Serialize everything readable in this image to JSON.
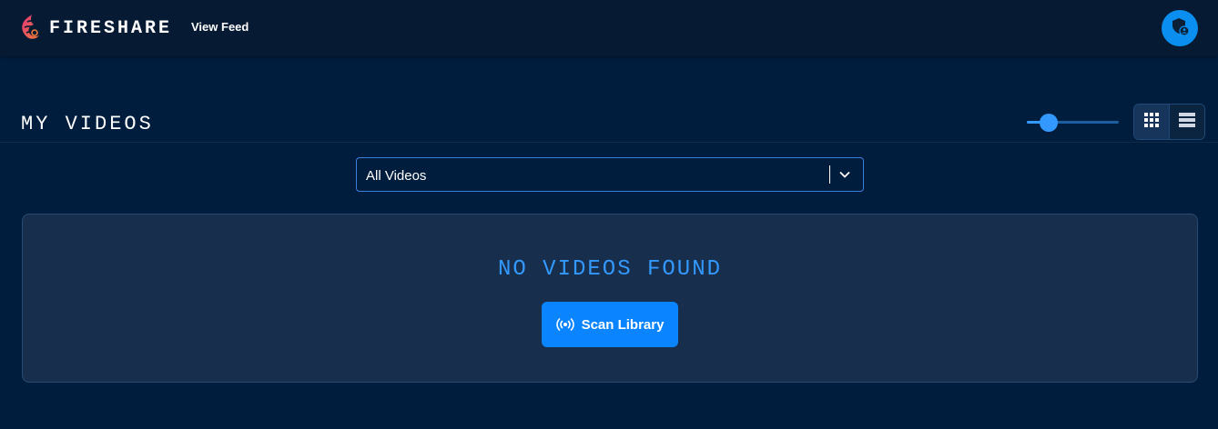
{
  "header": {
    "brand": "FIRESHARE",
    "logo_icon": "fireshare-logo-icon",
    "nav_link": "View Feed",
    "avatar_icon": "shield-user-icon"
  },
  "toolbar": {
    "title": "MY VIDEOS",
    "size_slider_level": 0.24,
    "views": [
      {
        "name": "grid-view",
        "icon": "grid-icon",
        "active": true
      },
      {
        "name": "list-view",
        "icon": "list-icon",
        "active": false
      }
    ]
  },
  "filter": {
    "selected": "All Videos",
    "icon": "chevron-down-icon"
  },
  "empty_state": {
    "message": "NO VIDEOS FOUND",
    "button_label": "Scan Library",
    "button_icon": "broadcast-icon"
  },
  "colors": {
    "background": "#001d3d",
    "header": "#061a33",
    "accent": "#3399ff",
    "button": "#0a84ff",
    "panel": "#172f4d"
  }
}
